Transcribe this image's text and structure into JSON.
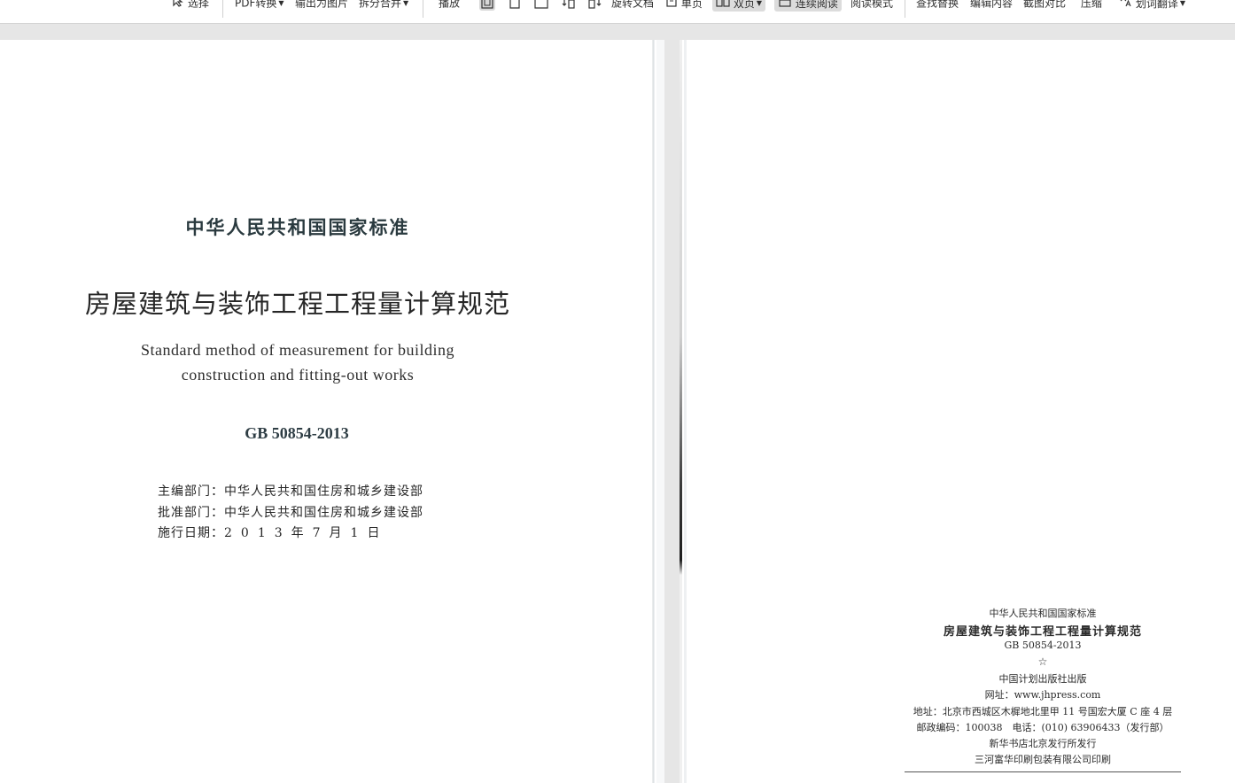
{
  "toolbar": {
    "select": "选择",
    "pdf_convert": "PDF转换",
    "export_image": "输出为图片",
    "split_merge": "拆分合并",
    "play": "播放",
    "rotate_doc": "旋转文档",
    "single_page": "单页",
    "double_page": "双页",
    "continuous_read": "连续阅读",
    "read_mode": "阅读模式",
    "find_replace": "查找替换",
    "edit_content": "编辑内容",
    "screenshot_compare": "截图对比",
    "compress": "压缩",
    "word_translate": "划词翻译"
  },
  "left_page": {
    "standard_name": "中华人民共和国国家标准",
    "title_cn": "房屋建筑与装饰工程工程量计算规范",
    "title_en_line1": "Standard method of measurement for building",
    "title_en_line2": "construction and fitting-out works",
    "code": "GB 50854-2013",
    "info": [
      {
        "label": "主编部门：",
        "value": "中华人民共和国住房和城乡建设部"
      },
      {
        "label": "批准部门：",
        "value": "中华人民共和国住房和城乡建设部"
      },
      {
        "label": "施行日期：",
        "value": "2013年7月1日"
      }
    ]
  },
  "right_page": {
    "colophon": {
      "standard_name": "中华人民共和国国家标准",
      "title": "房屋建筑与装饰工程工程量计算规范",
      "code": "GB 50854-2013",
      "star": "☆",
      "publisher": "中国计划出版社出版",
      "website": "网址：www.jhpress.com",
      "address": "地址：北京市西城区木樨地北里甲 11 号国宏大厦 C 座 4 层",
      "postal_phone": "邮政编码：100038　电话：(010) 63906433（发行部）",
      "distributor": "新华书店北京发行所发行",
      "printer": "三河富华印刷包装有限公司印刷"
    }
  }
}
